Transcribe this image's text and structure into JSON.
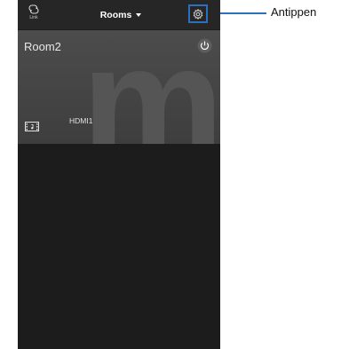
{
  "header": {
    "link_label": "Link",
    "title": "Rooms"
  },
  "room": {
    "name": "Room2",
    "input": "HDMI1",
    "background_letter": "m"
  },
  "callout": {
    "text": "Antippen"
  },
  "icons": {
    "link": "link-icon",
    "dropdown": "caret-down-icon",
    "settings": "gear-icon",
    "power": "power-icon",
    "input": "film-icon"
  },
  "colors": {
    "highlight": "#2d6fbd",
    "topbar": "#262626",
    "card": "#464646",
    "body": "#1c1c1c"
  }
}
